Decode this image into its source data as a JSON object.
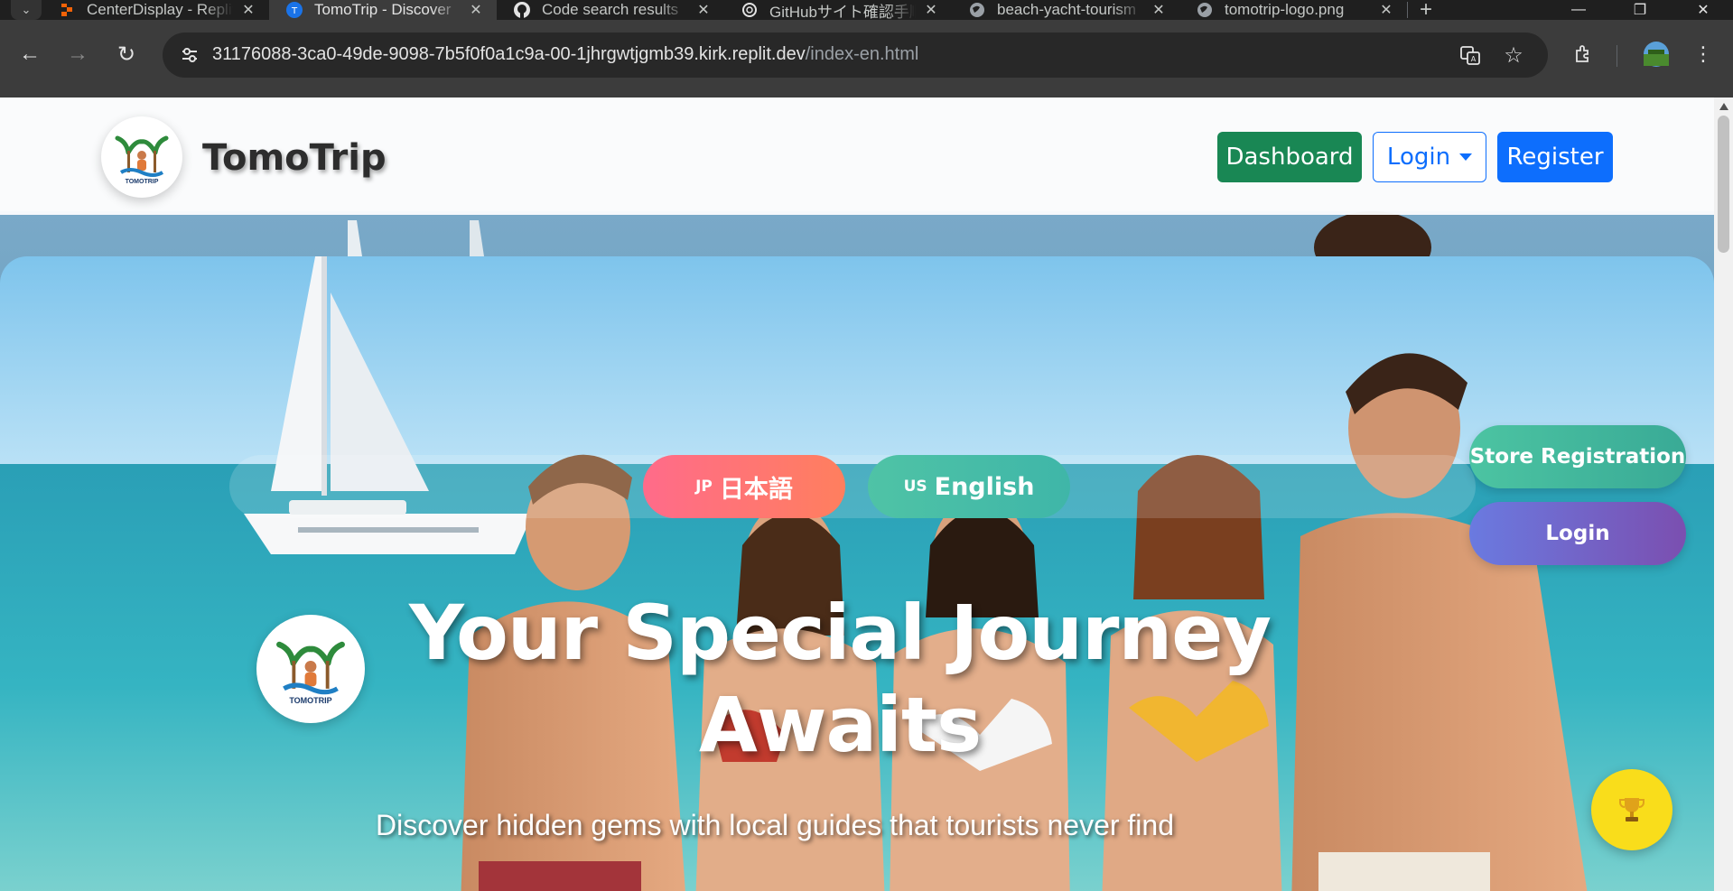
{
  "browser": {
    "tabs": [
      {
        "title": "CenterDisplay - Replit",
        "favicon": "replit-icon"
      },
      {
        "title": "TomoTrip - Discover",
        "favicon": "tomotrip-icon",
        "active": true
      },
      {
        "title": "Code search results",
        "favicon": "github-icon"
      },
      {
        "title": "GitHubサイト確認手順",
        "favicon": "chatgpt-icon"
      },
      {
        "title": "beach-yacht-tourism",
        "favicon": "globe-icon"
      },
      {
        "title": "tomotrip-logo.png",
        "favicon": "globe-icon"
      }
    ],
    "url_host": "31176088-3ca0-49de-9098-7b5f0f0a1c9a-00-1jhrgwtjgmb39.kirk.replit.dev",
    "url_path": "/index-en.html"
  },
  "header": {
    "brand": "TomoTrip",
    "logo_text": "TOMOTRIP",
    "dashboard_label": "Dashboard",
    "login_label": "Login",
    "register_label": "Register"
  },
  "hero": {
    "lang_jp_flag": "JP",
    "lang_jp_label": "日本語",
    "lang_en_flag": "US",
    "lang_en_label": "English",
    "store_registration_label": "Store Registration",
    "side_login_label": "Login",
    "title": "Your Special Journey Awaits",
    "subtitle": "Discover hidden gems with local guides that tourists never find"
  },
  "colors": {
    "dashboard": "#198754",
    "primary": "#0d6efd",
    "lang_jp": "#ff6b8a",
    "lang_en": "#4fc3a6",
    "trophy": "#f9dd1b"
  }
}
